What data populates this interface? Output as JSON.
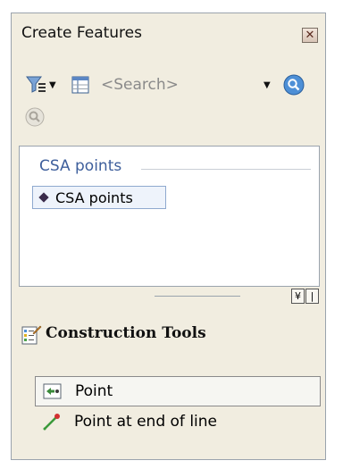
{
  "window": {
    "title": "Create Features"
  },
  "toolbar": {
    "search_placeholder": "<Search>"
  },
  "templates": {
    "group_header": "CSA points",
    "items": [
      {
        "label": "CSA points"
      }
    ]
  },
  "construction_tools": {
    "title": "Construction Tools",
    "items": [
      {
        "label": "Point",
        "icon": "point-tool-icon",
        "selected": true
      },
      {
        "label": "Point at end of line",
        "icon": "line-end-point-icon",
        "selected": false
      }
    ]
  },
  "colors": {
    "accent": "#3e5f9c",
    "panel_bg": "#f1ede0"
  }
}
